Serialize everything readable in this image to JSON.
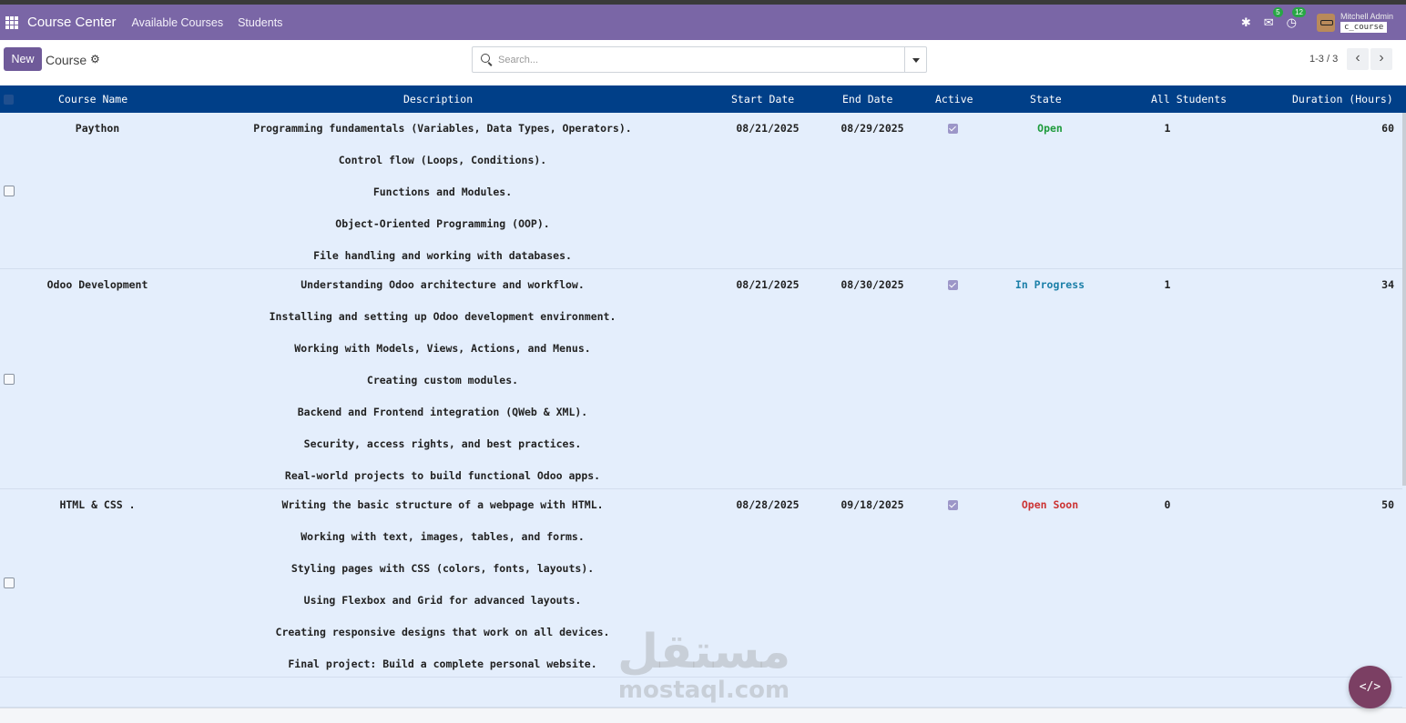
{
  "navbar": {
    "app_title": "Course Center",
    "menu": [
      "Available Courses",
      "Students"
    ],
    "messages_count": "5",
    "activities_count": "12",
    "user_name": "Mitchell Admin",
    "database": "c_course"
  },
  "control": {
    "new_label": "New",
    "breadcrumb": "Course",
    "search_placeholder": "Search...",
    "pager_value": "1-3 / 3"
  },
  "columns": [
    "Course Name",
    "Description",
    "Start Date",
    "End Date",
    "Active",
    "State",
    "All Students",
    "Duration (Hours)"
  ],
  "records": [
    {
      "name": "Paython",
      "description": [
        "Programming fundamentals (Variables, Data Types, Operators).",
        "Control flow (Loops, Conditions).",
        "Functions and Modules.",
        "Object-Oriented Programming (OOP).",
        "File handling and working with databases."
      ],
      "start_date": "08/21/2025",
      "end_date": "08/29/2025",
      "active": true,
      "state": "Open",
      "all_students": "1",
      "duration": "60"
    },
    {
      "name": "Odoo Development",
      "description": [
        "Understanding Odoo architecture and workflow.",
        "Installing and setting up Odoo development environment.",
        "Working with Models, Views, Actions, and Menus.",
        "Creating custom modules.",
        "Backend and Frontend integration (QWeb & XML).",
        "Security, access rights, and best practices.",
        "Real-world projects to build functional Odoo apps."
      ],
      "start_date": "08/21/2025",
      "end_date": "08/30/2025",
      "active": true,
      "state": "In Progress",
      "all_students": "1",
      "duration": "34"
    },
    {
      "name": "HTML & CSS .",
      "description": [
        "Writing the basic structure of a webpage with HTML.",
        "Working with text, images, tables, and forms.",
        "Styling pages with CSS (colors, fonts, layouts).",
        "Using Flexbox and Grid for advanced layouts.",
        "Creating responsive designs that work on all devices.",
        "Final project: Build a complete personal website."
      ],
      "start_date": "08/28/2025",
      "end_date": "09/18/2025",
      "active": true,
      "state": "Open Soon",
      "all_students": "0",
      "duration": "50"
    }
  ],
  "watermark": {
    "logo": "مستقل",
    "text": "mostaql.com"
  },
  "fab": {
    "label": "</>"
  },
  "colors": {
    "navbar": "#7a66a6",
    "header": "#003f88",
    "state_open": "#1e9b3c",
    "state_in_progress": "#1b7fa8",
    "state_open_soon": "#cc3333",
    "fab": "#7b3f63"
  },
  "icons": [
    "apps-icon",
    "bug-icon",
    "chat-icon",
    "clock-icon",
    "gear-icon",
    "search-icon",
    "chevron-down-icon",
    "chevron-left-icon",
    "chevron-right-icon",
    "code-icon"
  ]
}
